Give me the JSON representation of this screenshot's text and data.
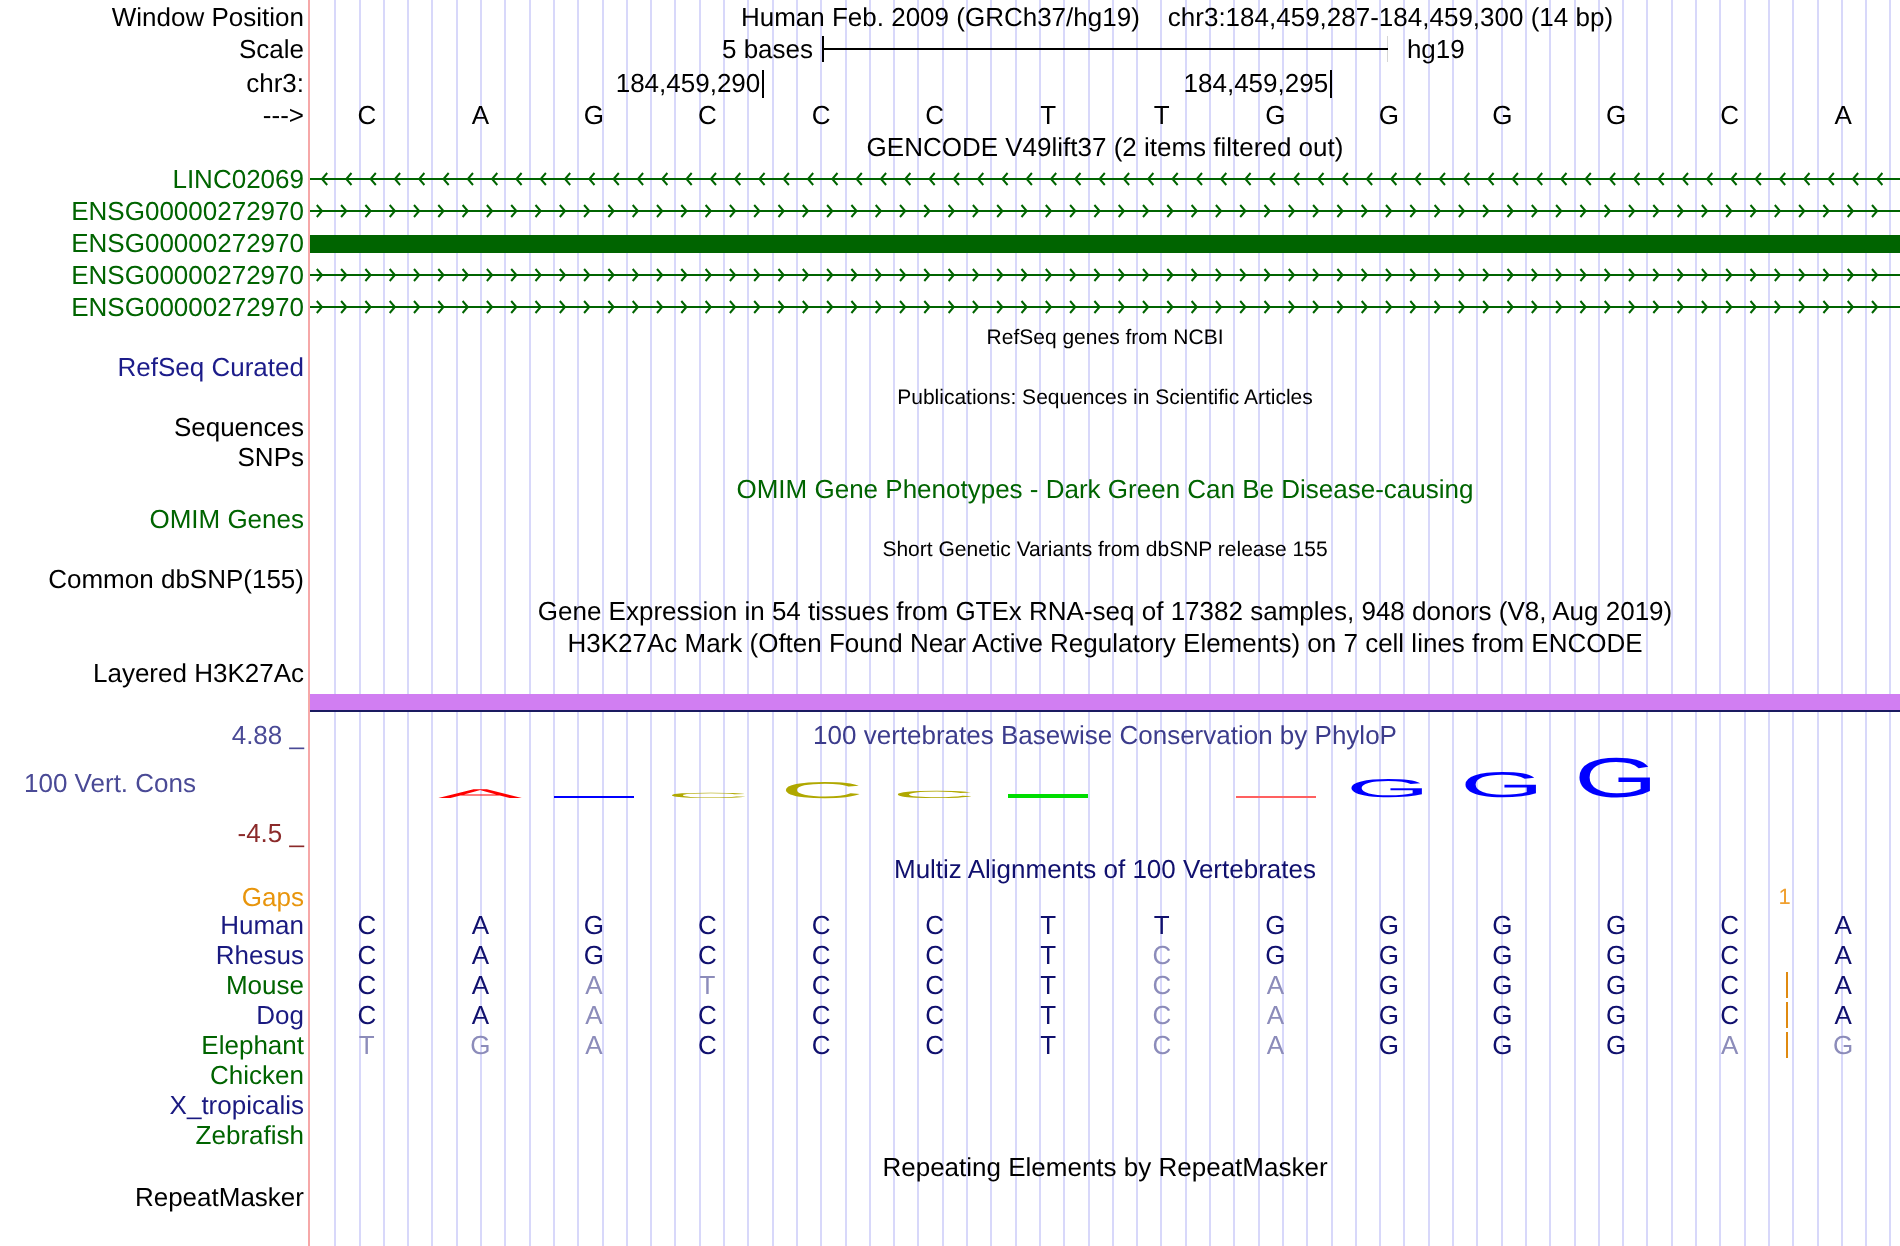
{
  "position": {
    "label": "Window Position",
    "assembly": "Human Feb. 2009 (GRCh37/hg19)",
    "range": "chr3:184,459,287-184,459,300 (14 bp)"
  },
  "scale": {
    "label": "Scale",
    "length": "5 bases",
    "assembly": "hg19"
  },
  "coordinates": {
    "label": "chr3:",
    "ticks": [
      "184,459,290",
      "184,459,295"
    ]
  },
  "sequence": {
    "label": "--->",
    "bases": [
      "C",
      "A",
      "G",
      "C",
      "C",
      "C",
      "T",
      "T",
      "G",
      "G",
      "G",
      "G",
      "C",
      "A"
    ]
  },
  "gencode": {
    "title": "GENCODE V49lift37 (2 items filtered out)",
    "items": [
      {
        "name": "LINC02069",
        "kind": "line",
        "reverse": true
      },
      {
        "name": "ENSG00000272970",
        "kind": "line",
        "reverse": false
      },
      {
        "name": "ENSG00000272970",
        "kind": "block",
        "reverse": false
      },
      {
        "name": "ENSG00000272970",
        "kind": "line",
        "reverse": false
      },
      {
        "name": "ENSG00000272970",
        "kind": "line",
        "reverse": false
      }
    ]
  },
  "tracks": [
    {
      "kind": "small_title",
      "text": "RefSeq genes from NCBI",
      "color": "#000000"
    },
    {
      "kind": "label",
      "text": "RefSeq Curated",
      "color": "#1c1c8a"
    },
    {
      "kind": "small_title",
      "text": "Publications: Sequences in Scientific Articles",
      "color": "#000000"
    },
    {
      "kind": "label",
      "text": "Sequences",
      "color": "#000000"
    },
    {
      "kind": "label",
      "text": "SNPs",
      "color": "#000000"
    },
    {
      "kind": "title",
      "text": "OMIM Gene Phenotypes - Dark Green Can Be Disease-causing",
      "color": "#006400"
    },
    {
      "kind": "label",
      "text": "OMIM Genes",
      "color": "#006400"
    },
    {
      "kind": "small_title",
      "text": "Short Genetic Variants from dbSNP release 155",
      "color": "#000000"
    },
    {
      "kind": "label",
      "text": "Common dbSNP(155)",
      "color": "#000000"
    },
    {
      "kind": "title",
      "text": "Gene Expression in 54 tissues from GTEx RNA-seq of 17382 samples, 948 donors (V8, Aug 2019)",
      "color": "#000000"
    },
    {
      "kind": "title",
      "text": "H3K27Ac Mark (Often Found Near Active Regulatory Elements) on 7 cell lines from ENCODE",
      "color": "#000000"
    },
    {
      "kind": "label",
      "text": "Layered H3K27Ac",
      "color": "#000000"
    },
    {
      "kind": "signal_bar",
      "color": "#d17ef2"
    }
  ],
  "conservation": {
    "title": "100 vertebrates Basewise Conservation by PhyloP",
    "label": "100 Vert. Cons",
    "max": "4.88 _",
    "min": "-4.5 _",
    "logo": [
      {
        "kind": "empty"
      },
      {
        "kind": "letter",
        "base": "A"
      },
      {
        "kind": "bar",
        "color": "#0000ff"
      },
      {
        "kind": "letter",
        "base": "C"
      },
      {
        "kind": "letter",
        "base": "C"
      },
      {
        "kind": "letter",
        "base": "C"
      },
      {
        "kind": "bar",
        "color": "#00dd00"
      },
      {
        "kind": "empty"
      },
      {
        "kind": "bar",
        "color": "#ff6060"
      },
      {
        "kind": "letter",
        "base": "G"
      },
      {
        "kind": "letter",
        "base": "G"
      },
      {
        "kind": "letter",
        "base": "G"
      },
      {
        "kind": "empty"
      },
      {
        "kind": "empty"
      }
    ]
  },
  "multiz": {
    "title": "Multiz Alignments of 100 Vertebrates",
    "gaps": {
      "label": "Gaps",
      "count": "1"
    },
    "species": [
      {
        "name": "Human",
        "color": "#1a1a80",
        "bases": [
          {
            "base": "C",
            "match": true,
            "insert_before": false
          },
          {
            "base": "A",
            "match": true,
            "insert_before": false
          },
          {
            "base": "G",
            "match": true,
            "insert_before": false
          },
          {
            "base": "C",
            "match": true,
            "insert_before": false
          },
          {
            "base": "C",
            "match": true,
            "insert_before": false
          },
          {
            "base": "C",
            "match": true,
            "insert_before": false
          },
          {
            "base": "T",
            "match": true,
            "insert_before": false
          },
          {
            "base": "T",
            "match": true,
            "insert_before": false
          },
          {
            "base": "G",
            "match": true,
            "insert_before": false
          },
          {
            "base": "G",
            "match": true,
            "insert_before": false
          },
          {
            "base": "G",
            "match": true,
            "insert_before": false
          },
          {
            "base": "G",
            "match": true,
            "insert_before": false
          },
          {
            "base": "C",
            "match": true,
            "insert_before": false
          },
          {
            "base": "A",
            "match": true,
            "insert_before": false
          }
        ]
      },
      {
        "name": "Rhesus",
        "color": "#1a1a80",
        "bases": [
          {
            "base": "C",
            "match": true,
            "insert_before": false
          },
          {
            "base": "A",
            "match": true,
            "insert_before": false
          },
          {
            "base": "G",
            "match": true,
            "insert_before": false
          },
          {
            "base": "C",
            "match": true,
            "insert_before": false
          },
          {
            "base": "C",
            "match": true,
            "insert_before": false
          },
          {
            "base": "C",
            "match": true,
            "insert_before": false
          },
          {
            "base": "T",
            "match": true,
            "insert_before": false
          },
          {
            "base": "C",
            "match": false,
            "insert_before": false
          },
          {
            "base": "G",
            "match": true,
            "insert_before": false
          },
          {
            "base": "G",
            "match": true,
            "insert_before": false
          },
          {
            "base": "G",
            "match": true,
            "insert_before": false
          },
          {
            "base": "G",
            "match": true,
            "insert_before": false
          },
          {
            "base": "C",
            "match": true,
            "insert_before": false
          },
          {
            "base": "A",
            "match": true,
            "insert_before": false
          }
        ]
      },
      {
        "name": "Mouse",
        "color": "#006400",
        "bases": [
          {
            "base": "C",
            "match": true,
            "insert_before": false
          },
          {
            "base": "A",
            "match": true,
            "insert_before": false
          },
          {
            "base": "A",
            "match": false,
            "insert_before": false
          },
          {
            "base": "T",
            "match": false,
            "insert_before": false
          },
          {
            "base": "C",
            "match": true,
            "insert_before": false
          },
          {
            "base": "C",
            "match": true,
            "insert_before": false
          },
          {
            "base": "T",
            "match": true,
            "insert_before": false
          },
          {
            "base": "C",
            "match": false,
            "insert_before": false
          },
          {
            "base": "A",
            "match": false,
            "insert_before": false
          },
          {
            "base": "G",
            "match": true,
            "insert_before": false
          },
          {
            "base": "G",
            "match": true,
            "insert_before": false
          },
          {
            "base": "G",
            "match": true,
            "insert_before": false
          },
          {
            "base": "C",
            "match": true,
            "insert_before": false
          },
          {
            "base": "A",
            "match": true,
            "insert_before": true
          }
        ]
      },
      {
        "name": "Dog",
        "color": "#1a1a80",
        "bases": [
          {
            "base": "C",
            "match": true,
            "insert_before": false
          },
          {
            "base": "A",
            "match": true,
            "insert_before": false
          },
          {
            "base": "A",
            "match": false,
            "insert_before": false
          },
          {
            "base": "C",
            "match": true,
            "insert_before": false
          },
          {
            "base": "C",
            "match": true,
            "insert_before": false
          },
          {
            "base": "C",
            "match": true,
            "insert_before": false
          },
          {
            "base": "T",
            "match": true,
            "insert_before": false
          },
          {
            "base": "C",
            "match": false,
            "insert_before": false
          },
          {
            "base": "A",
            "match": false,
            "insert_before": false
          },
          {
            "base": "G",
            "match": true,
            "insert_before": false
          },
          {
            "base": "G",
            "match": true,
            "insert_before": false
          },
          {
            "base": "G",
            "match": true,
            "insert_before": false
          },
          {
            "base": "C",
            "match": true,
            "insert_before": false
          },
          {
            "base": "A",
            "match": true,
            "insert_before": true
          }
        ]
      },
      {
        "name": "Elephant",
        "color": "#006400",
        "bases": [
          {
            "base": "T",
            "match": false,
            "insert_before": false
          },
          {
            "base": "G",
            "match": false,
            "insert_before": false
          },
          {
            "base": "A",
            "match": false,
            "insert_before": false
          },
          {
            "base": "C",
            "match": true,
            "insert_before": false
          },
          {
            "base": "C",
            "match": true,
            "insert_before": false
          },
          {
            "base": "C",
            "match": true,
            "insert_before": false
          },
          {
            "base": "T",
            "match": true,
            "insert_before": false
          },
          {
            "base": "C",
            "match": false,
            "insert_before": false
          },
          {
            "base": "A",
            "match": false,
            "insert_before": false
          },
          {
            "base": "G",
            "match": true,
            "insert_before": false
          },
          {
            "base": "G",
            "match": true,
            "insert_before": false
          },
          {
            "base": "G",
            "match": true,
            "insert_before": false
          },
          {
            "base": "A",
            "match": false,
            "insert_before": false
          },
          {
            "base": "G",
            "match": false,
            "insert_before": true
          }
        ]
      },
      {
        "name": "Chicken",
        "color": "#006400"
      },
      {
        "name": "X_tropicalis",
        "color": "#1a1a80"
      },
      {
        "name": "Zebrafish",
        "color": "#006400"
      }
    ]
  },
  "repeatmasker": {
    "title": "Repeating Elements by RepeatMasker",
    "label": "RepeatMasker"
  }
}
